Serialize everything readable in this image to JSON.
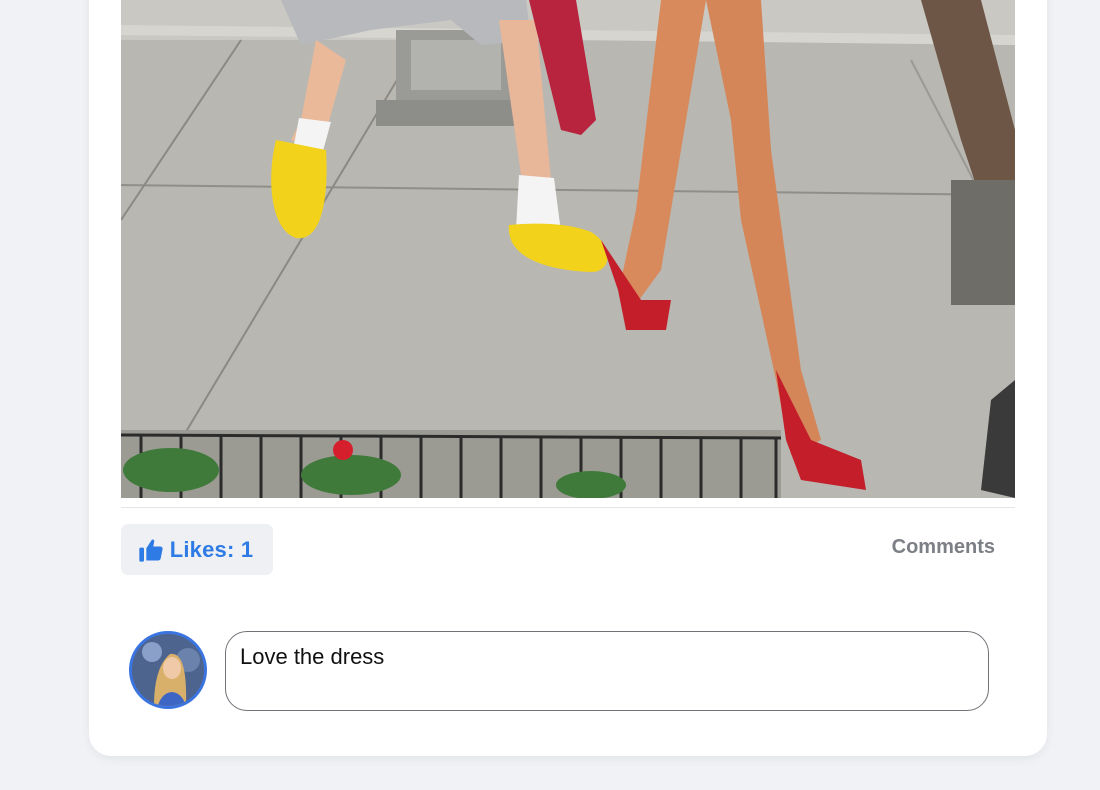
{
  "post": {
    "photo_alt": "Post photo",
    "like_icon": "thumbs-up-icon",
    "likes_label": "Likes: 1",
    "comments_label": "Comments"
  },
  "composer": {
    "avatar_alt": "User avatar",
    "comment_value": "Love the dress"
  },
  "colors": {
    "page_background": "#f0f2f5",
    "card_background": "#ffffff",
    "accent_blue": "#2f7be5",
    "like_button_background": "#eef0f4",
    "comments_gray": "#7c7f85"
  }
}
